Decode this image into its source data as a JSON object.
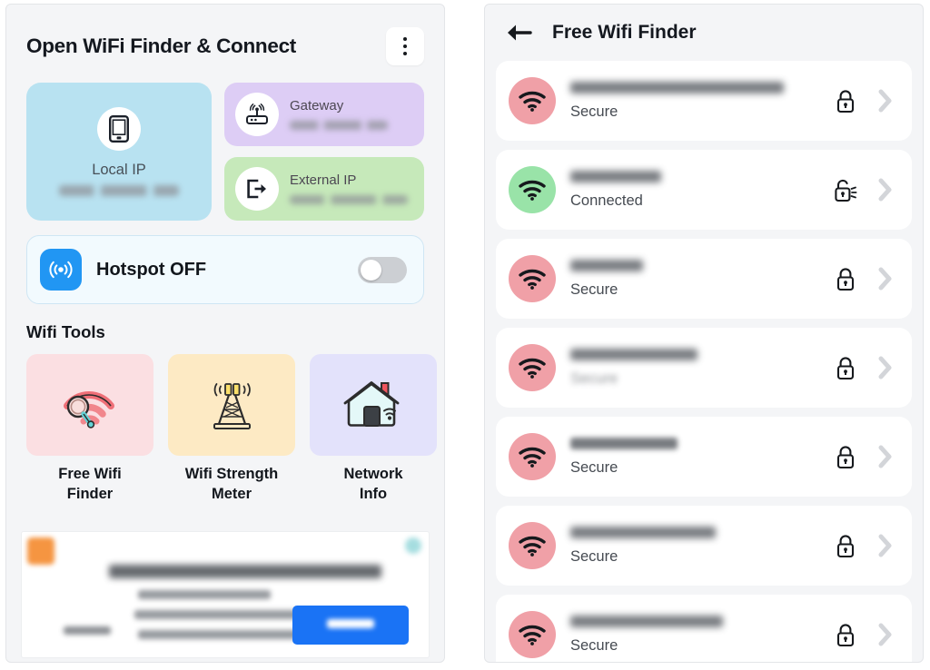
{
  "left_panel": {
    "app_title": "Open WiFi Finder & Connect",
    "menu_icon": "kebab-menu-icon",
    "local_ip_card": {
      "icon": "smartphone-icon",
      "label": "Local IP",
      "value": "",
      "value_redacted": true,
      "bg_color": "#b8e2f1"
    },
    "gateway_card": {
      "icon": "router-icon",
      "label": "Gateway",
      "value": "",
      "value_redacted": true,
      "bg_color": "#ddcdf5"
    },
    "external_ip_card": {
      "icon": "exit-arrow-icon",
      "label": "External IP",
      "value": "",
      "value_redacted": true,
      "bg_color": "#c6e9ba"
    },
    "hotspot": {
      "icon": "hotspot-broadcast-icon",
      "label": "Hotspot OFF",
      "enabled": false,
      "icon_bg": "#2196f3"
    },
    "tools_section_title": "Wifi Tools",
    "tools": [
      {
        "label": "Free Wifi\nFinder",
        "label_line1": "Free Wifi",
        "label_line2": "Finder",
        "icon": "wifi-search-icon",
        "bg_color": "#fbdfe2"
      },
      {
        "label": "Wifi Strength\nMeter",
        "label_line1": "Wifi Strength",
        "label_line2": "Meter",
        "icon": "cell-tower-icon",
        "bg_color": "#fdeac4"
      },
      {
        "label": "Network\nInfo",
        "label_line1": "Network",
        "label_line2": "Info",
        "icon": "home-wifi-icon",
        "bg_color": "#e3e2fb"
      }
    ],
    "advertisement": {
      "visible": true,
      "content_redacted": true,
      "cta_label": "",
      "cta_color": "#1a73f5"
    }
  },
  "right_panel": {
    "back_icon": "back-arrow-icon",
    "title": "Free Wifi Finder",
    "networks": [
      {
        "ssid": "",
        "ssid_redacted": true,
        "status": "Secure",
        "avatar_color": "#f0a0a7",
        "lock_icon": "lock-closed-icon",
        "chevron_icon": "chevron-right-icon"
      },
      {
        "ssid": "",
        "ssid_redacted": true,
        "status": "Connected",
        "avatar_color": "#99e3a8",
        "lock_icon": "lock-open-icon",
        "chevron_icon": "chevron-right-icon"
      },
      {
        "ssid": "",
        "ssid_redacted": true,
        "status": "Secure",
        "avatar_color": "#f0a0a7",
        "lock_icon": "lock-closed-icon",
        "chevron_icon": "chevron-right-icon"
      },
      {
        "ssid": "",
        "ssid_redacted": true,
        "status": "Secure",
        "avatar_color": "#f0a0a7",
        "lock_icon": "lock-closed-icon",
        "chevron_icon": "chevron-right-icon"
      },
      {
        "ssid": "",
        "ssid_redacted": true,
        "status": "Secure",
        "avatar_color": "#f0a0a7",
        "lock_icon": "lock-closed-icon",
        "chevron_icon": "chevron-right-icon"
      },
      {
        "ssid": "",
        "ssid_redacted": true,
        "status": "Secure",
        "avatar_color": "#f0a0a7",
        "lock_icon": "lock-closed-icon",
        "chevron_icon": "chevron-right-icon"
      },
      {
        "ssid": "",
        "ssid_redacted": true,
        "status": "Secure",
        "avatar_color": "#f0a0a7",
        "lock_icon": "lock-closed-icon",
        "chevron_icon": "chevron-right-icon"
      }
    ]
  }
}
